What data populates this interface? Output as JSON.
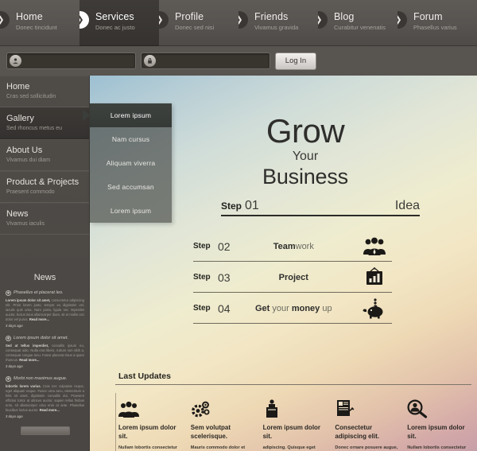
{
  "topnav": {
    "tabs": [
      {
        "label": "Home",
        "sub": "Donec tincidunt",
        "arrow": "❯",
        "active": false
      },
      {
        "label": "Services",
        "sub": "Donec ac justo",
        "arrow": "❯",
        "active": true
      },
      {
        "label": "Profile",
        "sub": "Donec sed nisi",
        "arrow": "❯",
        "active": false
      },
      {
        "label": "Friends",
        "sub": "Vivamus gravida",
        "arrow": "❯",
        "active": false
      },
      {
        "label": "Blog",
        "sub": "Curabitur venenatis",
        "arrow": "❯",
        "active": false
      },
      {
        "label": "Forum",
        "sub": "Phasellus varius",
        "arrow": "❯",
        "active": false
      }
    ]
  },
  "login": {
    "username": {
      "value": "",
      "placeholder": "",
      "icon": "user-icon",
      "glyph": "♟"
    },
    "password": {
      "value": "",
      "placeholder": "",
      "icon": "lock-icon",
      "glyph": "⚿"
    },
    "button_label": "Log In"
  },
  "sidebar": {
    "items": [
      {
        "label": "Home",
        "sub": "Cras sed sollicitudin",
        "active": false
      },
      {
        "label": "Gallery",
        "sub": "Sed rhoncus metus eu",
        "active": true
      },
      {
        "label": "About Us",
        "sub": "Vivamus dui diam",
        "active": false
      },
      {
        "label": "Product & Projects",
        "sub": "Praesent commodo",
        "active": false
      },
      {
        "label": "News",
        "sub": "Vivamus iaculis",
        "active": false
      }
    ],
    "news": {
      "heading": "News",
      "read_more": "Read more...",
      "button_label": "",
      "items": [
        {
          "title": "Phasellus et placerat leo.",
          "lead": "Lorem ipsum dolor sit amet,",
          "body": "consectetur adipiscing elit. Proin lorem justo, tempor eu dignissim vel, iaculis quis urna. Nam porta, ligula nec imperdiet auctor, lectus risus ullamcorper diam, sit et mollis orci dolor vel purus.",
          "ago": "3 days ago"
        },
        {
          "title": "Lorem ipsum dolor sit amet.",
          "lead": "Sed at tellus imperdiet,",
          "body": "convallis ipsum eu, consequat odio. Nulla erat libero, rutrum non nibh a, consequat congue arcu. Fusce placerat risus a quam rhoncus.",
          "ago": "3 days ago"
        },
        {
          "title": "Morbi non maximus augue.",
          "lead": "lobortis lorem varius.",
          "body": "Cras nec vulputate neque, eget aliquam neque. Fusce urna arcu, elementum a felis sit amet, dignissim convallis dui. Praesent efficitur tortor at ultrices auctor, sapien tellus finibus eros, sit ullamcorper urna eros at ante. Phasellus faucibus luctus auctor.",
          "ago": "3 days ago"
        }
      ]
    }
  },
  "submenu": {
    "items": [
      {
        "label": "Lorem ipsum",
        "active": true
      },
      {
        "label": "Nam cursus",
        "active": false
      },
      {
        "label": "Aliquam viverra",
        "active": false
      },
      {
        "label": "Sed accumsan",
        "active": false
      },
      {
        "label": "Lorem ipsum",
        "active": false
      }
    ]
  },
  "hero": {
    "line1": "Grow",
    "line2": "Your",
    "line3": "Business",
    "step01": {
      "word": "Step",
      "number": "01",
      "label": "Idea"
    }
  },
  "steps": [
    {
      "word": "Step",
      "number": "02",
      "text_bold": "Team",
      "text_light": "work",
      "text_bold2": "",
      "text_light2": "",
      "icon": "people-icon"
    },
    {
      "word": "Step",
      "number": "03",
      "text_bold": "Project",
      "text_light": "",
      "text_bold2": "",
      "text_light2": "",
      "icon": "chart-board-icon"
    },
    {
      "word": "Step",
      "number": "04",
      "text_bold": "Get",
      "text_light": " your ",
      "text_bold2": "money",
      "text_light2": " up",
      "icon": "piggy-bank-icon"
    }
  ],
  "updates": {
    "heading": "Last Updates",
    "cells": [
      {
        "title": "Lorem ipsum dolor sit.",
        "body": "Nullam lobortis consectetur adipiscing. Quisque eget",
        "icon": "group-icon"
      },
      {
        "title": "Sem volutpat scelerisque.",
        "body": "Mauris commodo dolor et ligula ornare, non auctor",
        "icon": "gears-icon"
      },
      {
        "title": "Lorem ipsum dolor sit.",
        "body": "adipiscing. Quisque eget libero a quam lobortis",
        "icon": "podium-icon"
      },
      {
        "title": "Consectetur adipiscing elit.",
        "body": "Donec ornare posuere augue, vel rutrum ligula imperdiet sit",
        "icon": "signature-doc-icon"
      },
      {
        "title": "Lorem ipsum dolor sit.",
        "body": "Nullam lobortis consectetur adipiscing. Quisque eget",
        "icon": "search-person-icon"
      }
    ]
  },
  "colors": {
    "nav_bg": "#575350",
    "nav_active": "#3a3734",
    "sidebar_bg": "#4d4945",
    "hero_top_left": "#9dc0d2",
    "hero_mid": "#efeccf",
    "hero_bottom_right": "#c79fa8",
    "text_dark": "#2e2e2c"
  }
}
